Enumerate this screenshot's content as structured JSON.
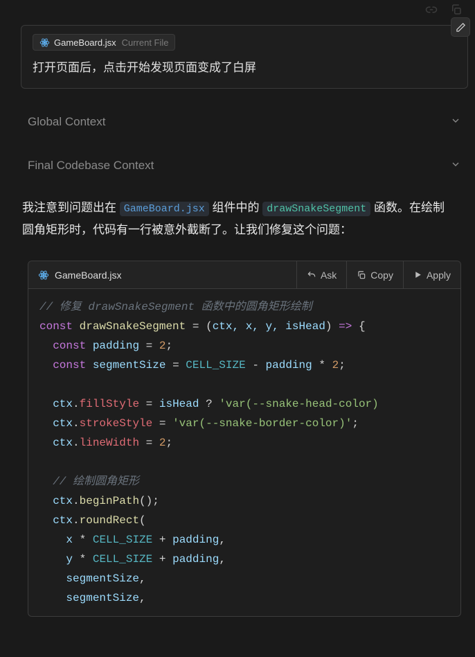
{
  "file_chip": {
    "icon": "react-icon",
    "name": "GameBoard.jsx",
    "hint": "Current File"
  },
  "prompt_text": "打开页面后，点击开始发现页面变成了白屏",
  "sections": {
    "global": "Global Context",
    "final": "Final Codebase Context"
  },
  "assistant": {
    "part1": "我注意到问题出在 ",
    "code1": "GameBoard.jsx",
    "part2": " 组件中的 ",
    "code2": "drawSnakeSegment",
    "part3": " 函数。在绘制圆角矩形时，代码有一行被意外截断了。让我们修复这个问题："
  },
  "code_card": {
    "filename": "GameBoard.jsx",
    "actions": {
      "ask": "Ask",
      "copy": "Copy",
      "apply": "Apply"
    }
  },
  "code": {
    "comment1": "// 修复 drawSnakeSegment 函数中的圆角矩形绘制",
    "const": "const",
    "fn_name": "drawSnakeSegment",
    "params": "ctx, x, y, isHead",
    "padding_var": "padding",
    "padding_val": "2",
    "segsize_var": "segmentSize",
    "cellsize": "CELL_SIZE",
    "mulpad": "padding",
    "two": "2",
    "ctx": "ctx",
    "fillStyle": "fillStyle",
    "isHead": "isHead",
    "str1": "'var(--snake-head-color)",
    "strokeStyle": "strokeStyle",
    "str2": "'var(--snake-border-color)'",
    "lineWidth": "lineWidth",
    "lw_val": "2",
    "comment2": "// 绘制圆角矩形",
    "beginPath": "beginPath",
    "roundRect": "roundRect",
    "x": "x",
    "y": "y",
    "seg": "segmentSize"
  }
}
